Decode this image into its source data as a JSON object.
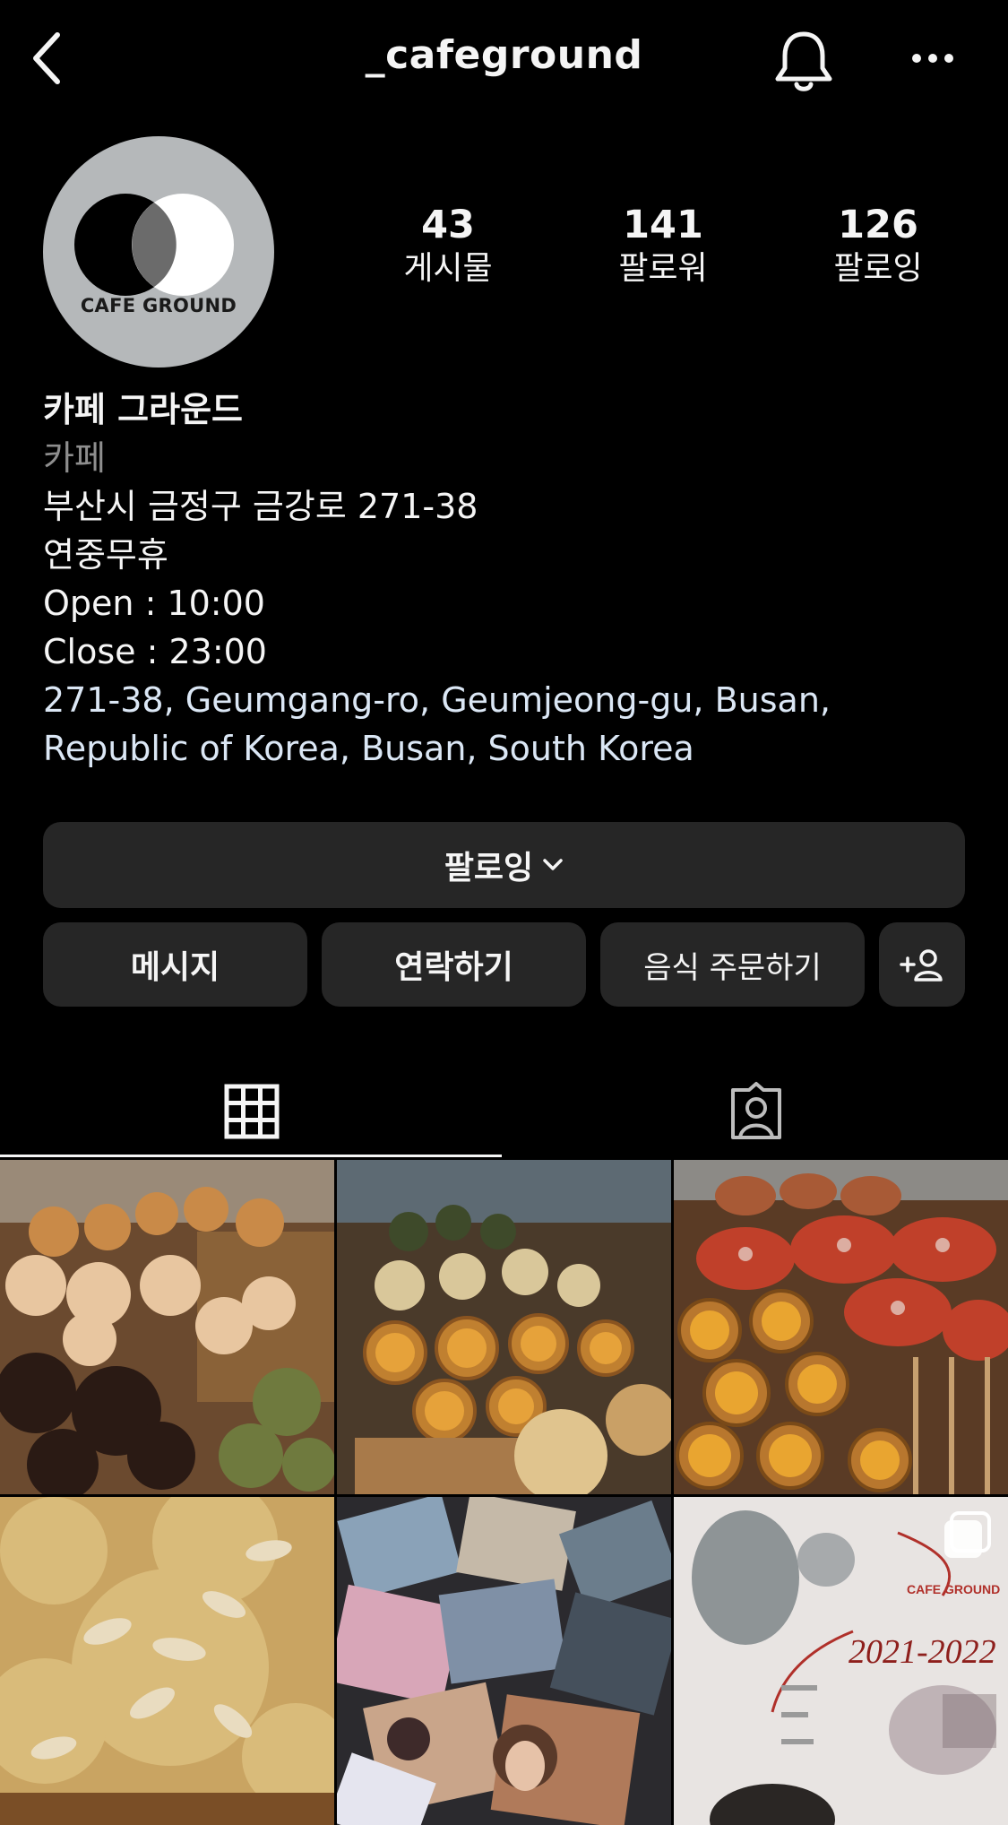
{
  "header": {
    "username": "_cafeground"
  },
  "profile": {
    "avatar_text": "CAFE GROUND",
    "stats": [
      {
        "value": "43",
        "label": "게시물"
      },
      {
        "value": "141",
        "label": "팔로워"
      },
      {
        "value": "126",
        "label": "팔로잉"
      }
    ]
  },
  "bio": {
    "name": "카페 그라운드",
    "category": "카페",
    "address": "부산시 금정구 금강로 271-38",
    "holiday": "연중무휴",
    "open": "Open : 10:00",
    "close": "Close : 23:00",
    "location_line1": "271-38, Geumgang-ro, Geumjeong-gu, Busan,",
    "location_line2": "Republic of Korea, Busan, South Korea"
  },
  "actions": {
    "following": "팔로잉",
    "message": "메시지",
    "contact": "연락하기",
    "order": "음식 주문하기"
  },
  "tabs": {
    "grid_icon": "grid-icon",
    "tagged_icon": "tagged-person-icon"
  },
  "posts": [
    {
      "subject": "scones-and-cookies"
    },
    {
      "subject": "egg-tarts-and-scones"
    },
    {
      "subject": "strawberry-croissants-and-tarts"
    },
    {
      "subject": "almond-pastry"
    },
    {
      "subject": "art-cards"
    },
    {
      "subject": "exhibition-poster",
      "poster_title": "CAFE GROUND",
      "poster_year": "2021-2022"
    }
  ],
  "colors": {
    "background": "#000000",
    "button": "#262626",
    "link": "#dbe7f5",
    "category": "#8e8e8e"
  }
}
